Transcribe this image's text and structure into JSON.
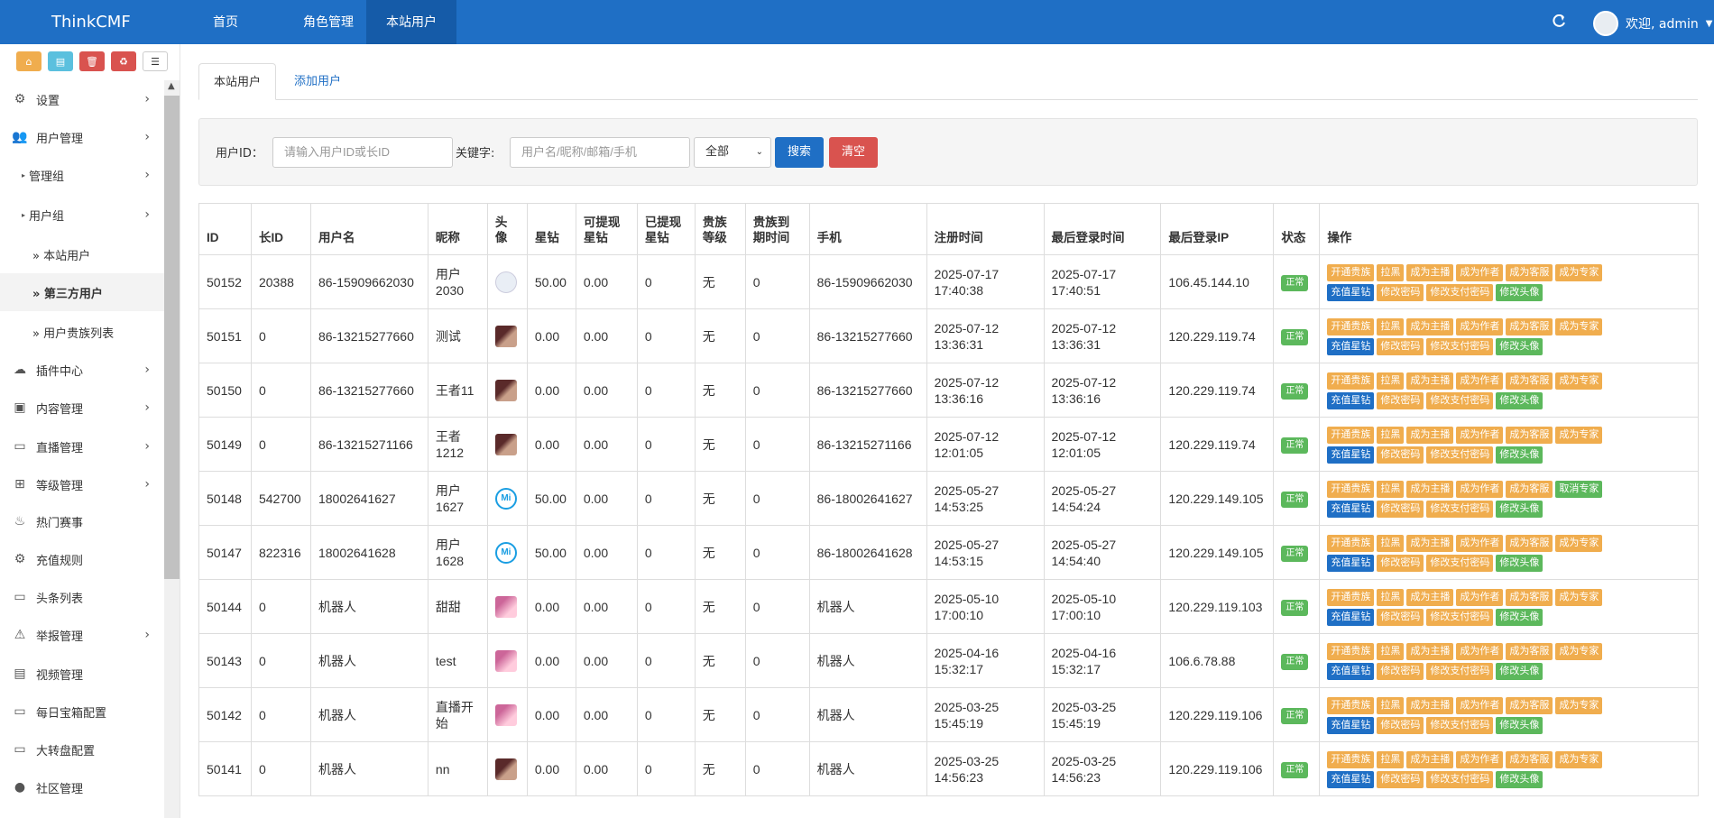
{
  "app": {
    "brand": "ThinkCMF",
    "welcome": "欢迎, admin"
  },
  "topnav": {
    "items": [
      "首页",
      "角色管理",
      "本站用户"
    ]
  },
  "sidebar": {
    "items": [
      {
        "label": "设置",
        "level": 1,
        "icon": "gears-icon"
      },
      {
        "label": "用户管理",
        "level": 1,
        "icon": "users-icon"
      },
      {
        "label": "管理组",
        "level": 2
      },
      {
        "label": "用户组",
        "level": 2
      },
      {
        "label": "» 本站用户",
        "level": 3
      },
      {
        "label": "» 第三方用户",
        "level": 3
      },
      {
        "label": "» 用户贵族列表",
        "level": 3
      },
      {
        "label": "插件中心",
        "level": 1,
        "icon": "cloud-icon"
      },
      {
        "label": "内容管理",
        "level": 1,
        "icon": "archive-icon"
      },
      {
        "label": "直播管理",
        "level": 1,
        "icon": "desktop-icon"
      },
      {
        "label": "等级管理",
        "level": 1,
        "icon": "sitemap-icon"
      },
      {
        "label": "热门赛事",
        "level": 1,
        "icon": "fire-icon"
      },
      {
        "label": "充值规则",
        "level": 1,
        "icon": "gear-icon"
      },
      {
        "label": "头条列表",
        "level": 1,
        "icon": "desktop-icon"
      },
      {
        "label": "举报管理",
        "level": 1,
        "icon": "warning-icon"
      },
      {
        "label": "视频管理",
        "level": 1,
        "icon": "file-icon"
      },
      {
        "label": "每日宝箱配置",
        "level": 1,
        "icon": "desktop-icon"
      },
      {
        "label": "大转盘配置",
        "level": 1,
        "icon": "desktop-icon"
      },
      {
        "label": "社区管理",
        "level": 1,
        "icon": "comment-icon"
      }
    ]
  },
  "tabs": {
    "active": "本站用户",
    "add": "添加用户"
  },
  "filter": {
    "uid_label": "用户ID：",
    "uid_placeholder": "请输入用户ID或长ID",
    "keyword_label": "关键字:",
    "keyword_placeholder": "用户名/昵称/邮箱/手机",
    "select_value": "全部",
    "search_btn": "搜索",
    "clear_btn": "清空"
  },
  "table": {
    "headers": [
      "ID",
      "长ID",
      "用户名",
      "昵称",
      "头像",
      "星钻",
      "可提现星钻",
      "已提现星钻",
      "贵族等级",
      "贵族到期时间",
      "手机",
      "注册时间",
      "最后登录时间",
      "最后登录IP",
      "状态",
      "操作"
    ],
    "header_lines": [
      [
        "ID"
      ],
      [
        "长ID"
      ],
      [
        "用户名"
      ],
      [
        "昵称"
      ],
      [
        "头",
        "像"
      ],
      [
        "星钻"
      ],
      [
        "可提现",
        "星钻"
      ],
      [
        "已提现",
        "星钻"
      ],
      [
        "贵族",
        "等级"
      ],
      [
        "贵族到",
        "期时间"
      ],
      [
        "手机"
      ],
      [
        "注册时间"
      ],
      [
        "最后登录时间"
      ],
      [
        "最后登录IP"
      ],
      [
        "状态"
      ],
      [
        "操作"
      ]
    ],
    "rows": [
      {
        "id": "50152",
        "long_id": "20388",
        "username": "86-15909662030",
        "nick": [
          "用户",
          "2030"
        ],
        "avatar": "face",
        "diamond": "50.00",
        "withdrawable": "0.00",
        "withdrawn": "0",
        "noble": "无",
        "noble_exp": "0",
        "phone": "86-15909662030",
        "reg": [
          "2025-07-17",
          "17:40:38"
        ],
        "last": [
          "2025-07-17",
          "17:40:51"
        ],
        "ip": "106.45.144.10",
        "status": "正常",
        "expert": "成为专家"
      },
      {
        "id": "50151",
        "long_id": "0",
        "username": "86-13215277660",
        "nick": [
          "测试"
        ],
        "avatar": "girl",
        "diamond": "0.00",
        "withdrawable": "0.00",
        "withdrawn": "0",
        "noble": "无",
        "noble_exp": "0",
        "phone": "86-13215277660",
        "reg": [
          "2025-07-12",
          "13:36:31"
        ],
        "last": [
          "2025-07-12",
          "13:36:31"
        ],
        "ip": "120.229.119.74",
        "status": "正常",
        "expert": "成为专家"
      },
      {
        "id": "50150",
        "long_id": "0",
        "username": "86-13215277660",
        "nick": [
          "王者11"
        ],
        "avatar": "girl",
        "diamond": "0.00",
        "withdrawable": "0.00",
        "withdrawn": "0",
        "noble": "无",
        "noble_exp": "0",
        "phone": "86-13215277660",
        "reg": [
          "2025-07-12",
          "13:36:16"
        ],
        "last": [
          "2025-07-12",
          "13:36:16"
        ],
        "ip": "120.229.119.74",
        "status": "正常",
        "expert": "成为专家"
      },
      {
        "id": "50149",
        "long_id": "0",
        "username": "86-13215271166",
        "nick": [
          "王者",
          "1212"
        ],
        "avatar": "girl",
        "diamond": "0.00",
        "withdrawable": "0.00",
        "withdrawn": "0",
        "noble": "无",
        "noble_exp": "0",
        "phone": "86-13215271166",
        "reg": [
          "2025-07-12",
          "12:01:05"
        ],
        "last": [
          "2025-07-12",
          "12:01:05"
        ],
        "ip": "120.229.119.74",
        "status": "正常",
        "expert": "成为专家"
      },
      {
        "id": "50148",
        "long_id": "542700",
        "username": "18002641627",
        "nick": [
          "用户",
          "1627"
        ],
        "avatar": "mi",
        "diamond": "50.00",
        "withdrawable": "0.00",
        "withdrawn": "0",
        "noble": "无",
        "noble_exp": "0",
        "phone": "86-18002641627",
        "reg": [
          "2025-05-27",
          "14:53:25"
        ],
        "last": [
          "2025-05-27",
          "14:54:24"
        ],
        "ip": "120.229.149.105",
        "status": "正常",
        "expert": "取消专家"
      },
      {
        "id": "50147",
        "long_id": "822316",
        "username": "18002641628",
        "nick": [
          "用户",
          "1628"
        ],
        "avatar": "mi",
        "diamond": "50.00",
        "withdrawable": "0.00",
        "withdrawn": "0",
        "noble": "无",
        "noble_exp": "0",
        "phone": "86-18002641628",
        "reg": [
          "2025-05-27",
          "14:53:15"
        ],
        "last": [
          "2025-05-27",
          "14:54:40"
        ],
        "ip": "120.229.149.105",
        "status": "正常",
        "expert": "成为专家"
      },
      {
        "id": "50144",
        "long_id": "0",
        "username": "机器人",
        "nick": [
          "甜甜"
        ],
        "avatar": "anime",
        "diamond": "0.00",
        "withdrawable": "0.00",
        "withdrawn": "0",
        "noble": "无",
        "noble_exp": "0",
        "phone": "机器人",
        "reg": [
          "2025-05-10",
          "17:00:10"
        ],
        "last": [
          "2025-05-10",
          "17:00:10"
        ],
        "ip": "120.229.119.103",
        "status": "正常",
        "expert": "成为专家"
      },
      {
        "id": "50143",
        "long_id": "0",
        "username": "机器人",
        "nick": [
          "test"
        ],
        "avatar": "anime",
        "diamond": "0.00",
        "withdrawable": "0.00",
        "withdrawn": "0",
        "noble": "无",
        "noble_exp": "0",
        "phone": "机器人",
        "reg": [
          "2025-04-16",
          "15:32:17"
        ],
        "last": [
          "2025-04-16",
          "15:32:17"
        ],
        "ip": "106.6.78.88",
        "status": "正常",
        "expert": "成为专家"
      },
      {
        "id": "50142",
        "long_id": "0",
        "username": "机器人",
        "nick": [
          "直播开",
          "始"
        ],
        "avatar": "anime",
        "diamond": "0.00",
        "withdrawable": "0.00",
        "withdrawn": "0",
        "noble": "无",
        "noble_exp": "0",
        "phone": "机器人",
        "reg": [
          "2025-03-25",
          "15:45:19"
        ],
        "last": [
          "2025-03-25",
          "15:45:19"
        ],
        "ip": "120.229.119.106",
        "status": "正常",
        "expert": "成为专家"
      },
      {
        "id": "50141",
        "long_id": "0",
        "username": "机器人",
        "nick": [
          "nn"
        ],
        "avatar": "girl",
        "diamond": "0.00",
        "withdrawable": "0.00",
        "withdrawn": "0",
        "noble": "无",
        "noble_exp": "0",
        "phone": "机器人",
        "reg": [
          "2025-03-25",
          "14:56:23"
        ],
        "last": [
          "2025-03-25",
          "14:56:23"
        ],
        "ip": "120.229.119.106",
        "status": "正常",
        "expert": "成为专家"
      }
    ],
    "ops_top": [
      "开通贵族",
      "拉黑",
      "成为主播",
      "成为作者",
      "成为客服"
    ],
    "ops_bottom": [
      {
        "label": "充值星钻",
        "color": "blue"
      },
      {
        "label": "修改密码",
        "color": "orange"
      },
      {
        "label": "修改支付密码",
        "color": "orange"
      },
      {
        "label": "修改头像",
        "color": "green"
      }
    ]
  }
}
